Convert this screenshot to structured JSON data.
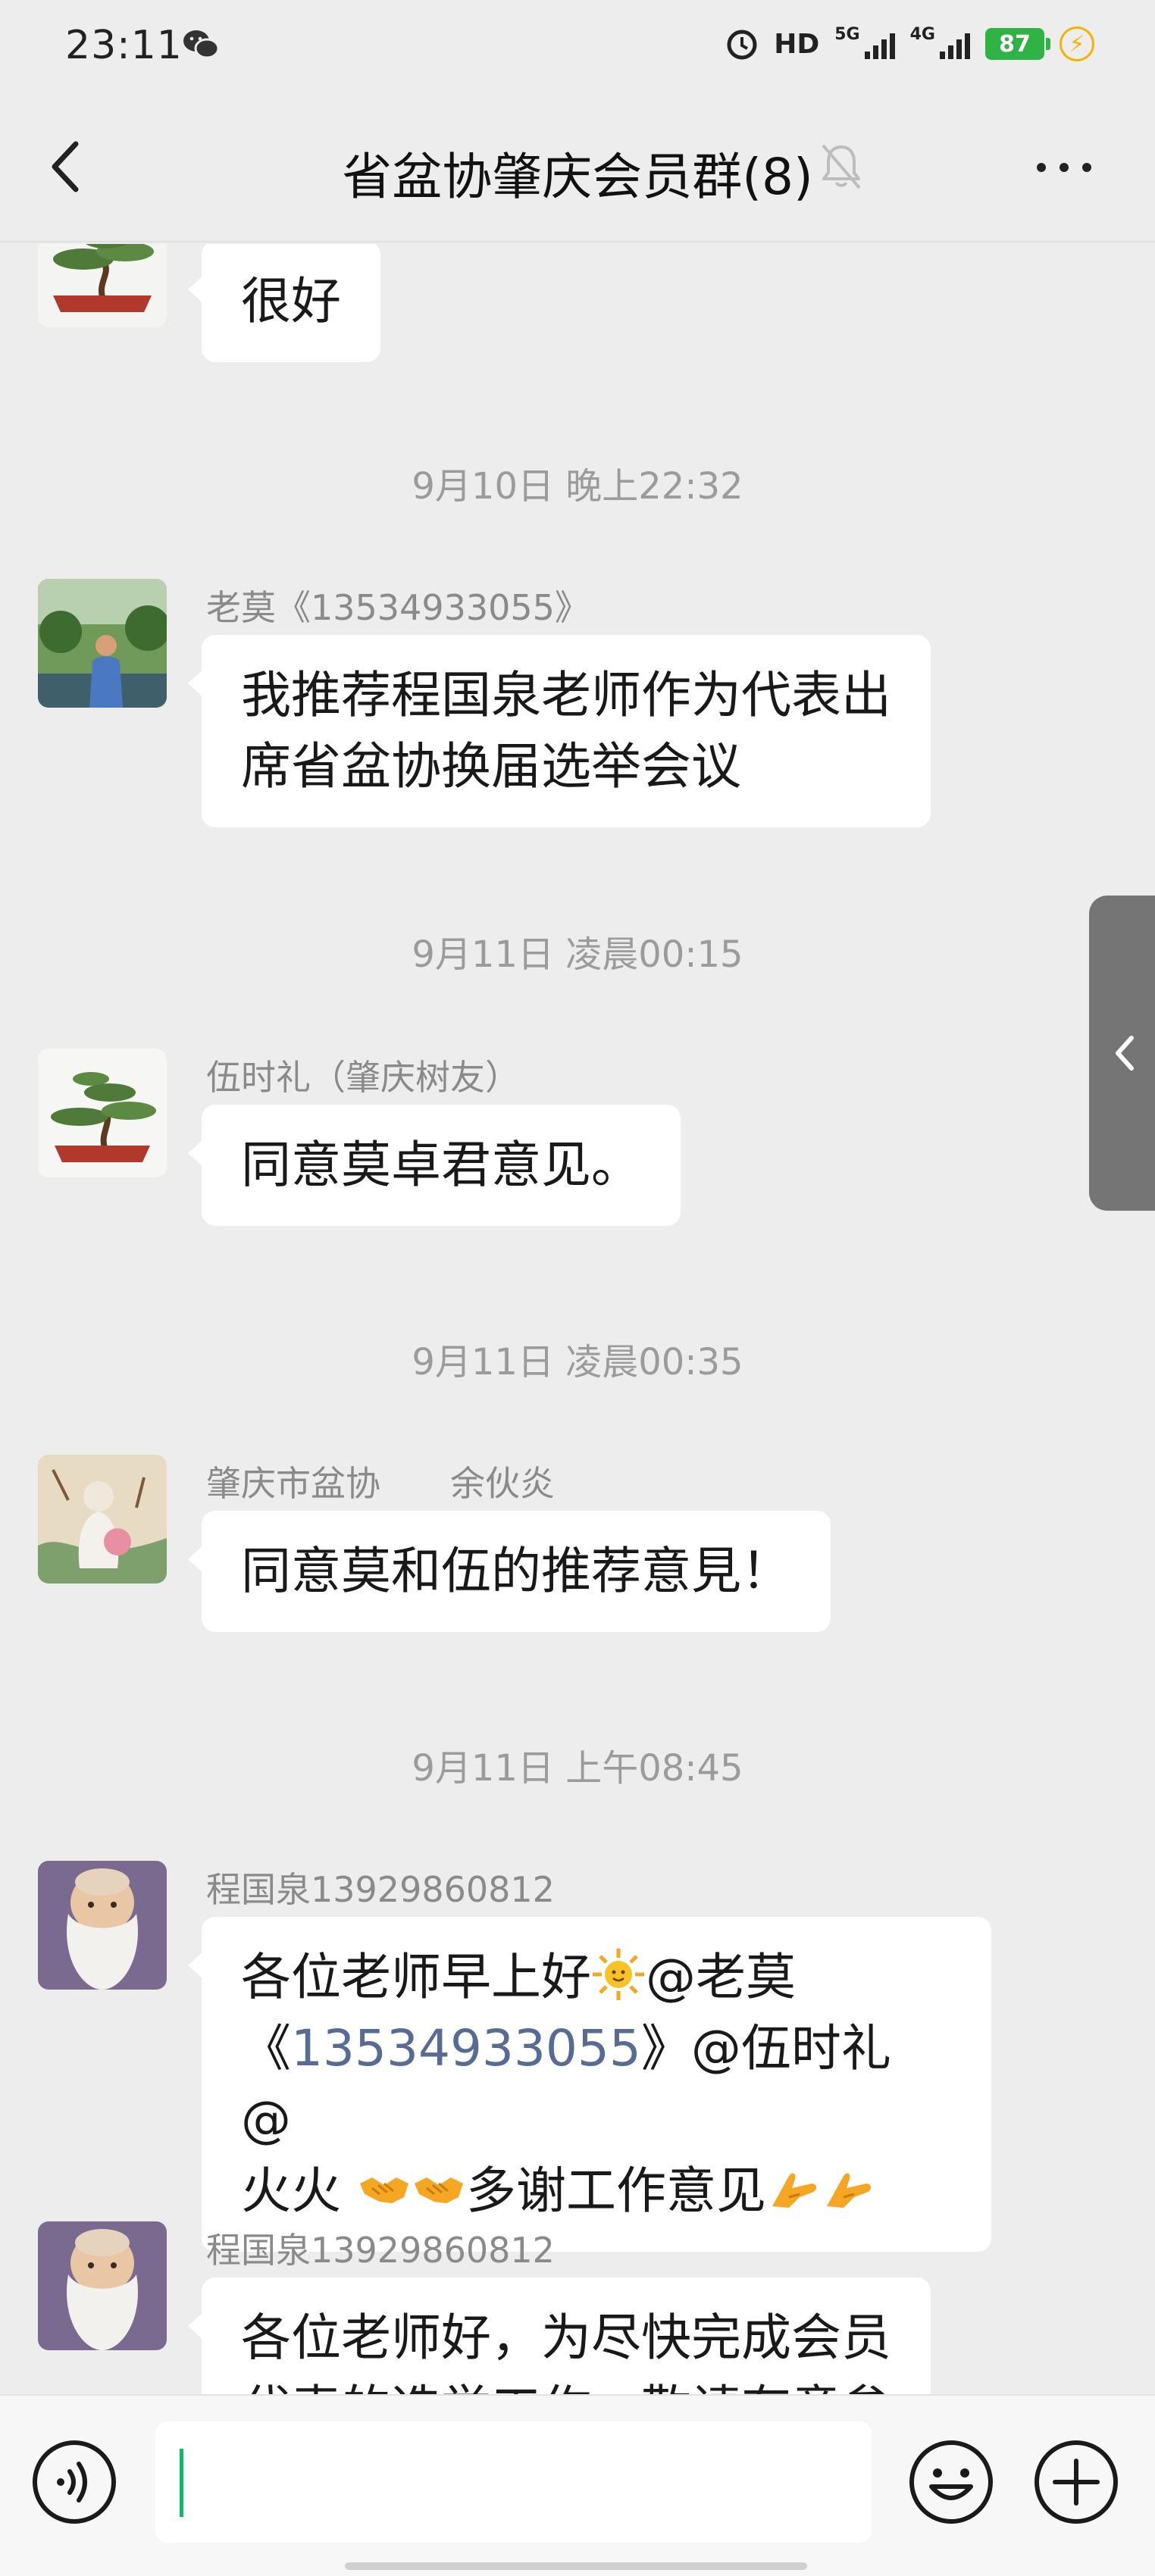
{
  "status_bar": {
    "time": "23:11",
    "icons": [
      "wechat-icon",
      "alarm-icon",
      "hd-icon",
      "signal-5g-icon",
      "signal-4g-icon",
      "battery-icon",
      "charging-icon"
    ],
    "hd_label": "HD",
    "net1_label": "5G",
    "net2_label": "4G",
    "battery_level": "87",
    "battery_color": "#2fb344"
  },
  "nav": {
    "title": "省盆协肇庆会员群(8)"
  },
  "messages": [
    {
      "sender": "",
      "text": "很好"
    },
    {
      "timestamp": "9月10日 晚上22:32"
    },
    {
      "sender": "老莫《13534933055》",
      "lines": [
        "我推荐程国泉老师作为代表出",
        "席省盆协换届选举会议"
      ]
    },
    {
      "timestamp": "9月11日 凌晨00:15"
    },
    {
      "sender": "伍时礼（肇庆树友）",
      "text": "同意莫卓君意见。"
    },
    {
      "timestamp": "9月11日 凌晨00:35"
    },
    {
      "sender": "肇庆市盆协　　余伙炎",
      "text": "同意莫和伍的推荐意見！"
    },
    {
      "timestamp": "9月11日 上午08:45"
    },
    {
      "sender": "程国泉13929860812",
      "line1_a": "各位老师早上好",
      "line1_b": "@老莫",
      "line2_a": "《",
      "line2_link": "13534933055",
      "line2_b": "》@伍时礼 @",
      "line3_a": "火火 ",
      "line3_b": "多谢工作意见"
    },
    {
      "sender": "程国泉13929860812",
      "lines": [
        "各位老师好，为尽快完成会员",
        "代表的选举工作，敬请有意参"
      ]
    }
  ],
  "input": {
    "value": "",
    "placeholder": ""
  },
  "colors": {
    "background": "#ededed",
    "bubble": "#ffffff",
    "link": "#576b95",
    "caret": "#07c160",
    "timestamp": "#9b9b9b"
  }
}
